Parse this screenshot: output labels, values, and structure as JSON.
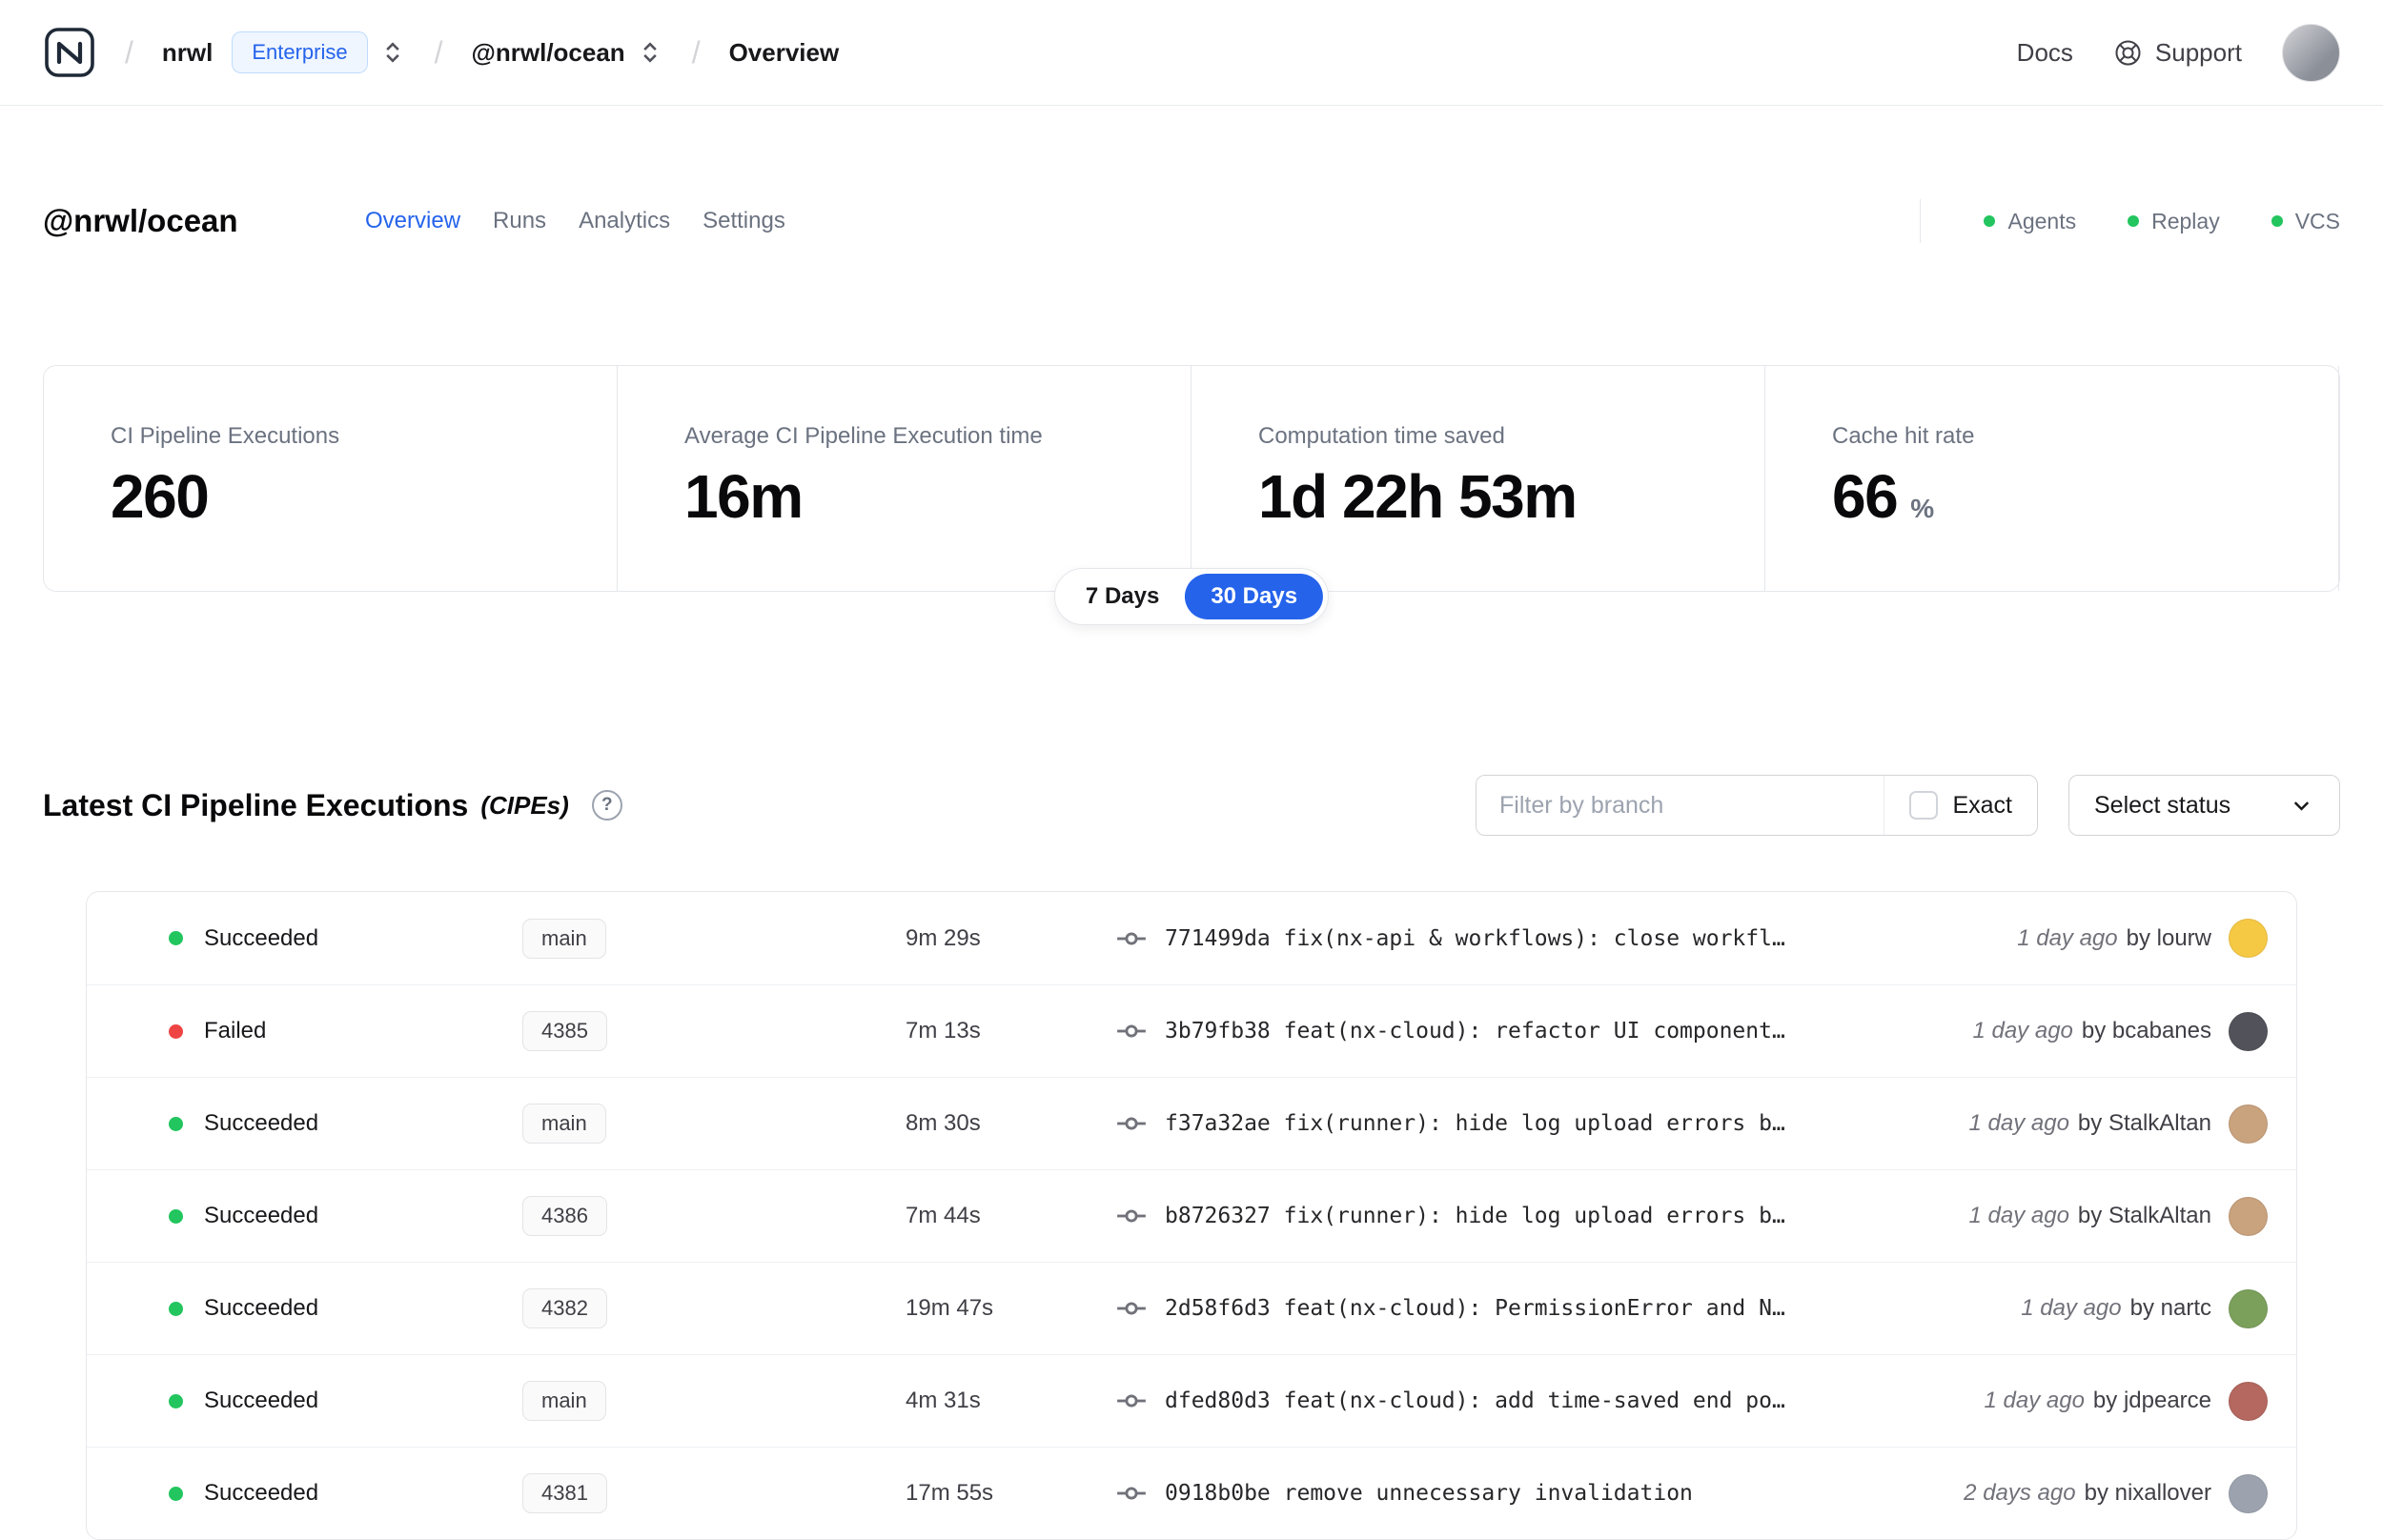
{
  "colors": {
    "accent": "#2563eb",
    "success": "#22c55e",
    "failure": "#ef4444"
  },
  "header": {
    "org": "nrwl",
    "org_badge": "Enterprise",
    "workspace": "@nrwl/ocean",
    "page": "Overview",
    "docs_label": "Docs",
    "support_label": "Support"
  },
  "workspace_header": {
    "title": "@nrwl/ocean",
    "tabs": [
      {
        "label": "Overview"
      },
      {
        "label": "Runs"
      },
      {
        "label": "Analytics"
      },
      {
        "label": "Settings"
      }
    ],
    "legend": [
      {
        "label": "Agents"
      },
      {
        "label": "Replay"
      },
      {
        "label": "VCS"
      }
    ]
  },
  "stats": {
    "cards": [
      {
        "label": "CI Pipeline Executions",
        "value": "260",
        "suffix": ""
      },
      {
        "label": "Average CI Pipeline Execution time",
        "value": "16m",
        "suffix": ""
      },
      {
        "label": "Computation time saved",
        "value": "1d 22h 53m",
        "suffix": ""
      },
      {
        "label": "Cache hit rate",
        "value": "66",
        "suffix": "%"
      }
    ],
    "toggle": [
      {
        "label": "7 Days"
      },
      {
        "label": "30 Days"
      }
    ]
  },
  "cipes": {
    "title": "Latest CI Pipeline Executions",
    "title_suffix": "(CIPEs)",
    "help_glyph": "?",
    "filter_placeholder": "Filter by branch",
    "exact_label": "Exact",
    "status_select_label": "Select status",
    "rows": [
      {
        "status": "Succeeded",
        "status_color": "#22c55e",
        "branch": "main",
        "duration": "9m 29s",
        "commit": "771499da fix(nx-api & workflows): close workfl…",
        "time": "1 day ago",
        "author": "by lourw",
        "avatar_color": "#f6c945"
      },
      {
        "status": "Failed",
        "status_color": "#ef4444",
        "branch": "4385",
        "duration": "7m 13s",
        "commit": "3b79fb38 feat(nx-cloud): refactor UI component…",
        "time": "1 day ago",
        "author": "by bcabanes",
        "avatar_color": "#52525b"
      },
      {
        "status": "Succeeded",
        "status_color": "#22c55e",
        "branch": "main",
        "duration": "8m 30s",
        "commit": "f37a32ae fix(runner): hide log upload errors b…",
        "time": "1 day ago",
        "author": "by StalkAltan",
        "avatar_color": "#c9a27e"
      },
      {
        "status": "Succeeded",
        "status_color": "#22c55e",
        "branch": "4386",
        "duration": "7m 44s",
        "commit": "b8726327 fix(runner): hide log upload errors b…",
        "time": "1 day ago",
        "author": "by StalkAltan",
        "avatar_color": "#c9a27e"
      },
      {
        "status": "Succeeded",
        "status_color": "#22c55e",
        "branch": "4382",
        "duration": "19m 47s",
        "commit": "2d58f6d3 feat(nx-cloud): PermissionError and N…",
        "time": "1 day ago",
        "author": "by nartc",
        "avatar_color": "#7ba05b"
      },
      {
        "status": "Succeeded",
        "status_color": "#22c55e",
        "branch": "main",
        "duration": "4m 31s",
        "commit": "dfed80d3 feat(nx-cloud): add time-saved end po…",
        "time": "1 day ago",
        "author": "by jdpearce",
        "avatar_color": "#b4685f"
      },
      {
        "status": "Succeeded",
        "status_color": "#22c55e",
        "branch": "4381",
        "duration": "17m 55s",
        "commit": "0918b0be remove unnecessary invalidation",
        "time": "2 days ago",
        "author": "by nixallover",
        "avatar_color": "#9ca3af"
      }
    ]
  }
}
